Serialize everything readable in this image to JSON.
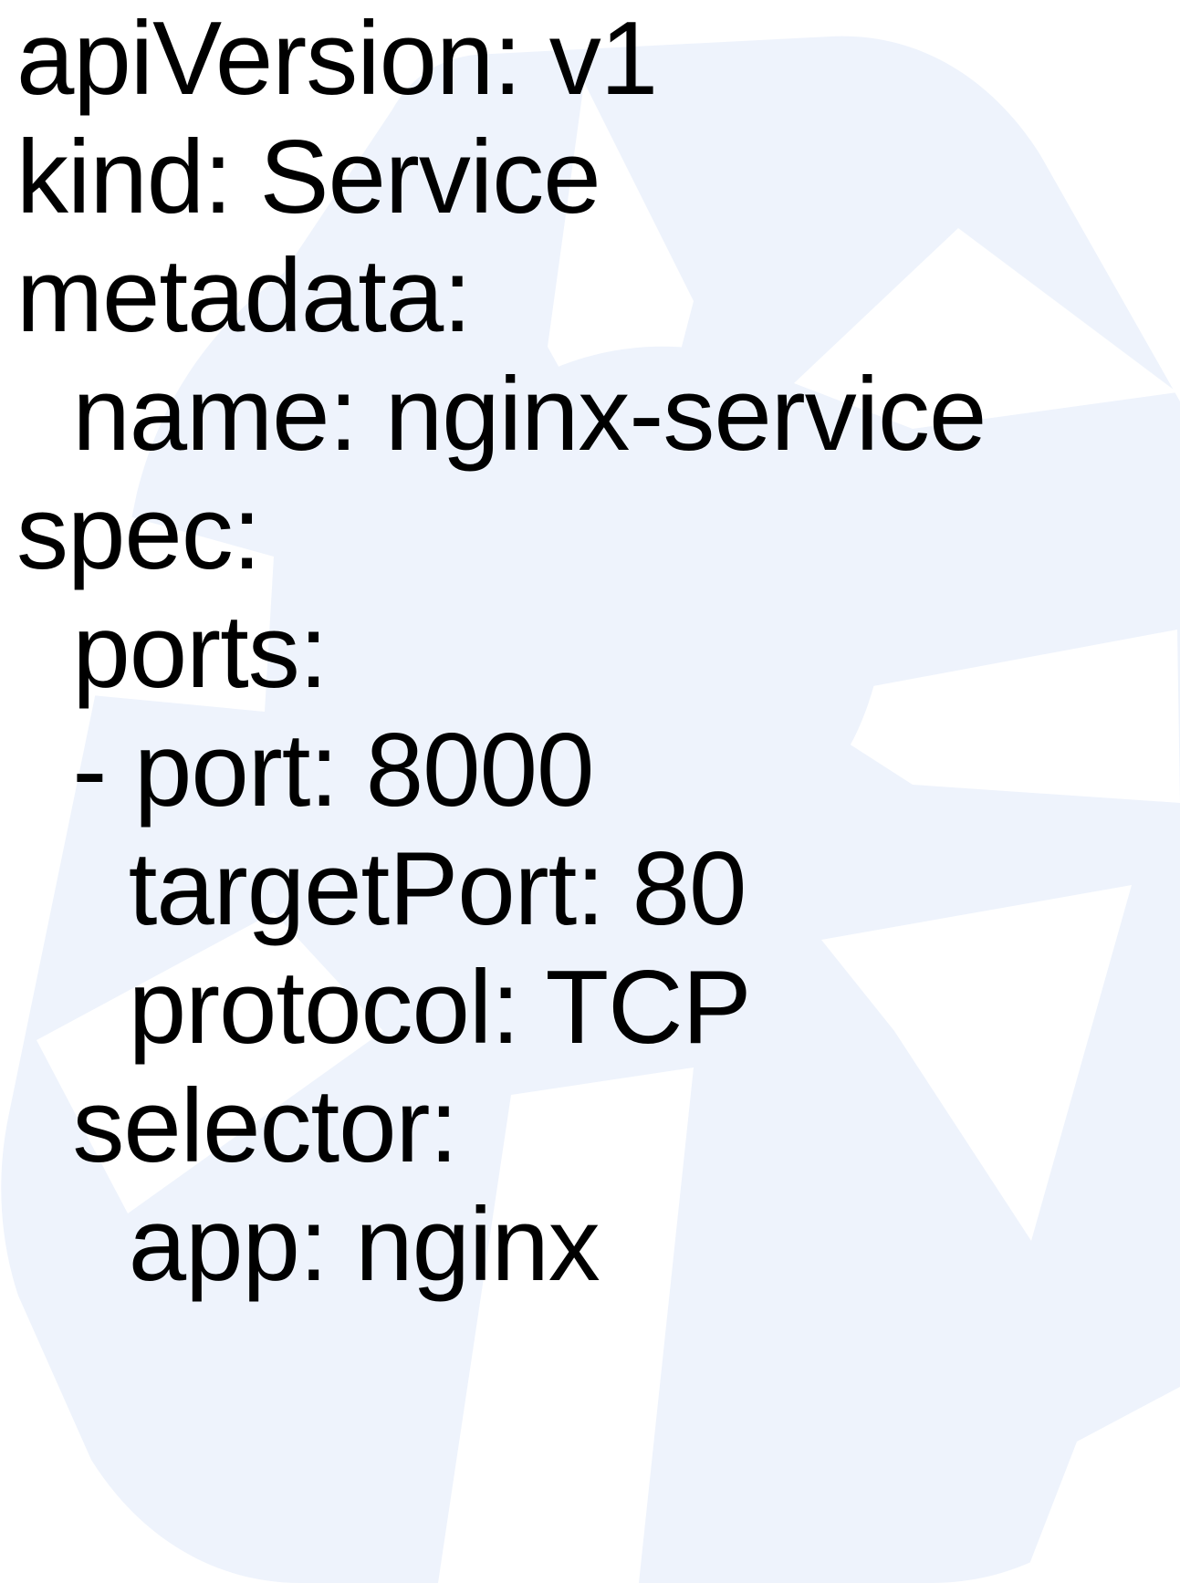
{
  "document": {
    "lines": [
      "apiVersion: v1",
      "kind: Service",
      "metadata:",
      "  name: nginx-service",
      "spec:",
      "  ports:",
      "  - port: 8000",
      "    targetPort: 80",
      "    protocol: TCP",
      "  selector:",
      "    app: nginx"
    ]
  },
  "colors": {
    "text": "#000000",
    "background": "#ffffff",
    "watermark": "#eef3fc"
  },
  "icons": {
    "background_logo": "kubernetes-wheel-watermark-icon"
  }
}
